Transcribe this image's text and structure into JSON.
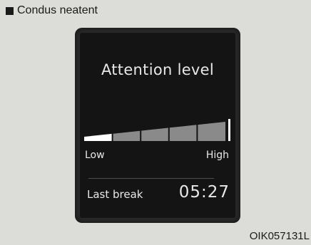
{
  "header": {
    "title": "Condus neatent"
  },
  "display": {
    "title": "Attention level",
    "gauge": {
      "low_label": "Low",
      "high_label": "High",
      "level_fraction": 0.2,
      "segments": 5
    },
    "last_break": {
      "label": "Last break",
      "time": "05:27"
    }
  },
  "caption": "OIK057131L",
  "colors": {
    "screen_bg": "#141414",
    "bezel": "#2b2b2b",
    "active_segment": "#ffffff",
    "inactive_segment": "#8a8a8a",
    "text": "#e8e8e8"
  }
}
